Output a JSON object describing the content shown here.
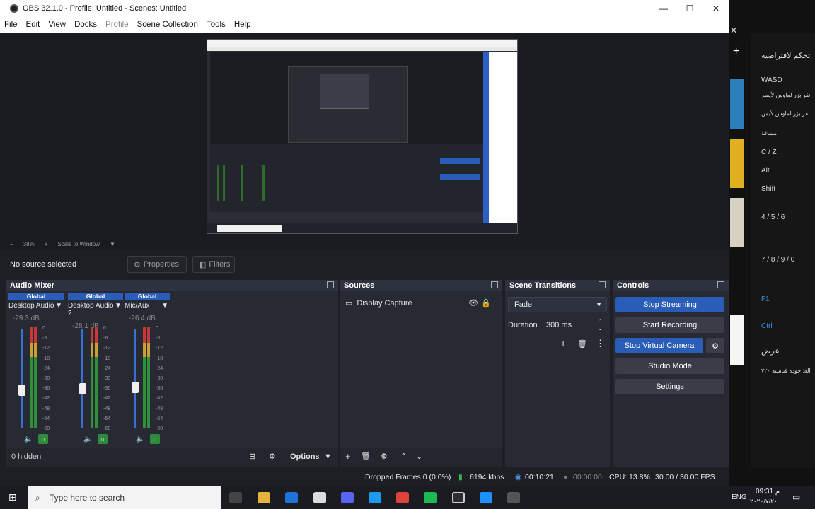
{
  "window": {
    "title": "OBS 32.1.0 - Profile: Untitled - Scenes: Untitled"
  },
  "menu": [
    "File",
    "Edit",
    "View",
    "Docks",
    "Profile",
    "Scene Collection",
    "Tools",
    "Help"
  ],
  "zoombar": {
    "minus": "−",
    "zoom": "38%",
    "plus": "+",
    "scale": "Scale to Window"
  },
  "source_bar": {
    "no_source": "No source selected",
    "properties": "Properties",
    "filters": "Filters"
  },
  "audio_mixer": {
    "title": "Audio Mixer",
    "channels": [
      {
        "global": "Global",
        "name": "Desktop Audio",
        "db": "-29.3 dB",
        "fader": 0.47
      },
      {
        "global": "Global",
        "name": "Desktop Audio 2",
        "db": "-28.1 dB",
        "fader": 0.52
      },
      {
        "global": "Global",
        "name": "Mic/Aux",
        "db": "-26.4 dB",
        "fader": 0.53
      }
    ],
    "ticks": [
      "0",
      "-6",
      "-12",
      "-18",
      "-24",
      "-30",
      "-36",
      "-42",
      "-48",
      "-54",
      "-60"
    ],
    "hidden": "0 hidden",
    "options": "Options"
  },
  "sources": {
    "title": "Sources",
    "items": [
      {
        "name": "Display Capture"
      }
    ]
  },
  "transitions": {
    "title": "Scene Transitions",
    "type": "Fade",
    "duration_label": "Duration",
    "duration": "300 ms"
  },
  "controls": {
    "title": "Controls",
    "buttons": [
      "Stop Streaming",
      "Start Recording",
      "Stop Virtual Camera",
      "Studio Mode",
      "Settings"
    ]
  },
  "status": {
    "dropped": "Dropped Frames 0 (0.0%)",
    "kbps": "6194 kbps",
    "stream_time": "00:10:21",
    "rec_time": "00:00:00",
    "cpu": "CPU: 13.8%",
    "fps": "30.00 / 30.00 FPS"
  },
  "taskbar": {
    "search": "Type here to search",
    "time": "09:31 م",
    "date": "٢٠٢٠/٧/٢٠",
    "lang": "ENG"
  },
  "right_panel": {
    "header": "تحكم لافتراضية",
    "rows": [
      "WASD",
      "نقر بزر لماوس لأيسر",
      "نقر بزر لماوس لأيمن",
      "مسافة",
      "C / Z",
      "Alt",
      "Shift",
      "4 / 5 / 6",
      "7 / 8 / 9 / 0",
      "F1",
      "Ctrl",
      "عرض",
      "الة: جودة قياسية ٧٢٠"
    ]
  },
  "colors": {
    "accent": "#2a5db8",
    "panel": "#272a33",
    "bg": "#1e1f24"
  }
}
